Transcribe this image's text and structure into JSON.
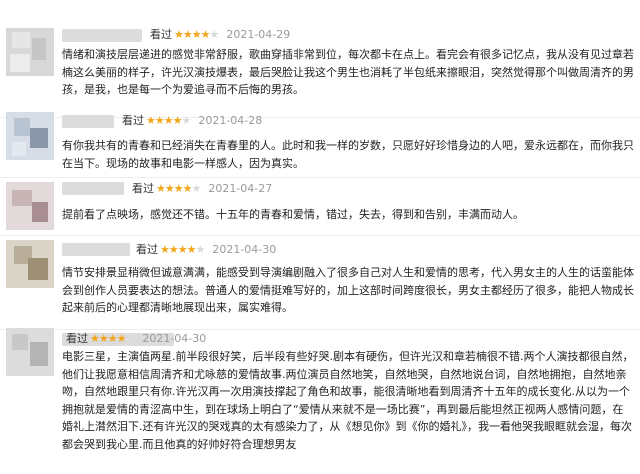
{
  "reviews": [
    {
      "label": "看过",
      "rating": 4,
      "date": "2021-04-29",
      "text": "情绪和演技层层递进的感觉非常舒服，歌曲穿插非常到位，每次都卡在点上。看完会有很多记忆点，我从没有见过章若楠这么美丽的样子，许光汉演技爆表，最后哭脸让我这个男生也消耗了半包纸来擦眼泪，突然觉得那个叫做周清齐的男孩，是我，也是每一个为爱追寻而不后悔的男孩。"
    },
    {
      "label": "看过",
      "rating": 4,
      "date": "2021-04-28",
      "text": "有你我共有的青春和已经消失在青春里的人。此时和我一样的岁数，只愿好好珍惜身边的人吧，爱永远都在，而你我只在当下。现场的故事和电影一样感人，因为真实。"
    },
    {
      "label": "看过",
      "rating": 4,
      "date": "2021-04-27",
      "text": "提前看了点映场，感觉还不错。十五年的青春和爱情，错过，失去，得到和告别，丰满而动人。"
    },
    {
      "label": "看过",
      "rating": 4,
      "date": "2021-04-30",
      "text": "情节安排景显稍微但诚意满满，能感受到导演编剧融入了很多自己对人生和爱情的思考，代入男女主的人生的话蛮能体会到创作人员要表达的想法。普通人的爱情挺难写好的，加上这部时间跨度很长，男女主都经历了很多，能把人物成长起来前后的心理都清晰地展现出来，属实难得。"
    },
    {
      "label": "看过",
      "rating": 4,
      "date": "2021-04-30",
      "text": "电影三星，主演值两星.前半段很好笑，后半段有些好哭.剧本有硬伤，但许光汉和章若楠很不错.两个人演技都很自然，他们让我愿意相信周清齐和尤咏慈的爱情故事.两位演员自然地笑，自然地哭，自然地说台词，自然地拥抱，自然地亲吻，自然地跟里只有你.许光汉再一次用演技撑起了角色和故事，能很清晰地看到周清齐十五年的成长变化.从以为一个拥抱就是爱情的青涩高中生，到在球场上明白了“爱情从来就不是一场比赛”，再到最后能坦然正视两人感情问题，在婚礼上潸然泪下.还有许光汉的哭戏真的太有感染力了，从《想见你》到《你的婚礼》，我一看他哭我眼眶就会湿，每次都会哭到我心里.而且他真的好帅好符合理想男友"
    }
  ]
}
